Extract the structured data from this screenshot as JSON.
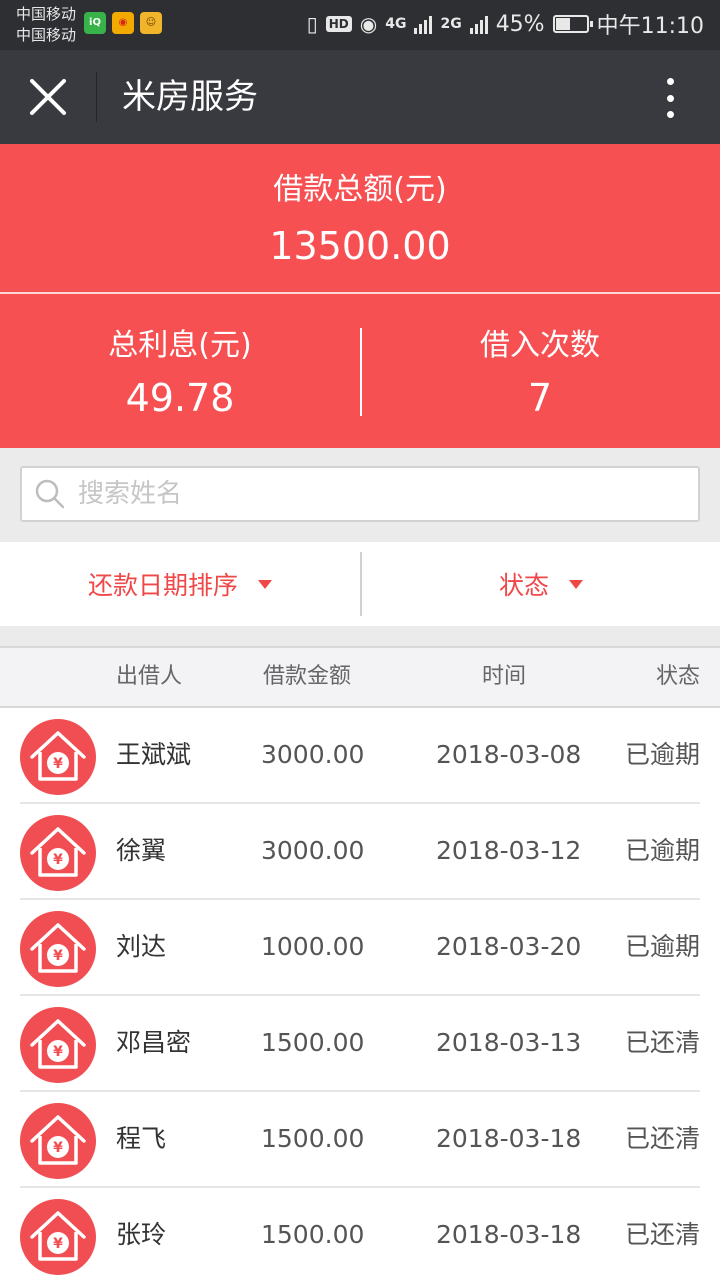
{
  "status_bar": {
    "carrier_1": "中国移动",
    "carrier_2": "中国移动",
    "apps": [
      "iqiyi-icon",
      "weibo-icon",
      "game-icon"
    ],
    "hd": "HD",
    "net_4g": "4G",
    "net_2g": "2G",
    "battery_percent": "45%",
    "battery_level": 0.45,
    "time": "中午11:10"
  },
  "titlebar": {
    "title": "米房服务"
  },
  "summary": {
    "total_loan_label": "借款总额(元)",
    "total_loan_value": "13500.00",
    "total_interest_label": "总利息(元)",
    "total_interest_value": "49.78",
    "borrow_count_label": "借入次数",
    "borrow_count_value": "7"
  },
  "search": {
    "placeholder": "搜索姓名",
    "value": ""
  },
  "filters": {
    "sort_label": "还款日期排序",
    "status_label": "状态"
  },
  "table": {
    "headers": {
      "lender": "出借人",
      "amount": "借款金额",
      "time": "时间",
      "status": "状态"
    },
    "rows": [
      {
        "name": "王斌斌",
        "amount": "3000.00",
        "date": "2018-03-08",
        "status": "已逾期"
      },
      {
        "name": "徐翼",
        "amount": "3000.00",
        "date": "2018-03-12",
        "status": "已逾期"
      },
      {
        "name": "刘达",
        "amount": "1000.00",
        "date": "2018-03-20",
        "status": "已逾期"
      },
      {
        "name": "邓昌密",
        "amount": "1500.00",
        "date": "2018-03-13",
        "status": "已还清"
      },
      {
        "name": "程飞",
        "amount": "1500.00",
        "date": "2018-03-18",
        "status": "已还清"
      },
      {
        "name": "张玲",
        "amount": "1500.00",
        "date": "2018-03-18",
        "status": "已还清"
      }
    ],
    "avatar_glyph": "¥"
  },
  "colors": {
    "accent": "#f75052",
    "titlebar": "#393a3f",
    "filter_text": "#f04848"
  }
}
